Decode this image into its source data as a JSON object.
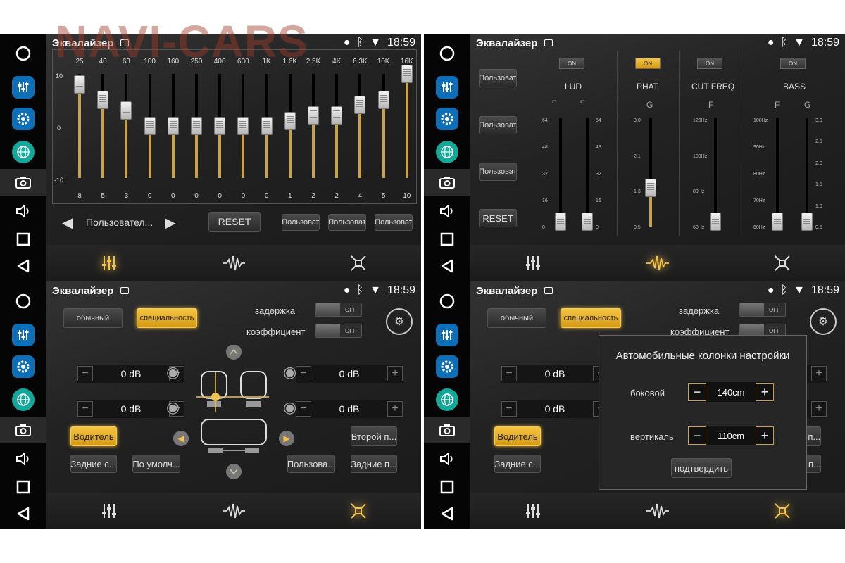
{
  "watermark": "NAVI-CARS",
  "status": {
    "title": "Эквалайзер",
    "time": "18:59"
  },
  "eq": {
    "scale": {
      "top": "10",
      "mid": "0",
      "bottom": "-10"
    },
    "bands": [
      {
        "freq": "25",
        "value": "8",
        "level": 8
      },
      {
        "freq": "40",
        "value": "5",
        "level": 5
      },
      {
        "freq": "63",
        "value": "3",
        "level": 3
      },
      {
        "freq": "100",
        "value": "0",
        "level": 0
      },
      {
        "freq": "160",
        "value": "0",
        "level": 0
      },
      {
        "freq": "250",
        "value": "0",
        "level": 0
      },
      {
        "freq": "400",
        "value": "0",
        "level": 0
      },
      {
        "freq": "630",
        "value": "0",
        "level": 0
      },
      {
        "freq": "1K",
        "value": "0",
        "level": 0
      },
      {
        "freq": "1.6K",
        "value": "1",
        "level": 1
      },
      {
        "freq": "2.5K",
        "value": "2",
        "level": 2
      },
      {
        "freq": "4K",
        "value": "2",
        "level": 2
      },
      {
        "freq": "6.3K",
        "value": "4",
        "level": 4
      },
      {
        "freq": "10K",
        "value": "5",
        "level": 5
      },
      {
        "freq": "16K",
        "value": "10",
        "level": 10
      }
    ],
    "preset_label": "Пользовател...",
    "reset": "RESET",
    "presets": [
      "Пользоват",
      "Пользоват",
      "Пользоват"
    ]
  },
  "advanced": {
    "presets": [
      "Пользоват",
      "Пользоват",
      "Пользоват"
    ],
    "reset": "RESET",
    "on": "ON",
    "lud": {
      "label": "LUD",
      "ticks": [
        "64",
        "48",
        "32",
        "16",
        "0"
      ]
    },
    "phat": {
      "label": "PHAT",
      "sub": "G",
      "ticks": [
        "3.0",
        "2.1",
        "1.3",
        "0.5"
      ]
    },
    "cut": {
      "label": "CUT FREQ",
      "sub": "F",
      "ticks": [
        "120Hz",
        "100Hz",
        "80Hz",
        "60Hz"
      ]
    },
    "bass": {
      "label": "BASS",
      "sub_f": "F",
      "sub_g": "G",
      "f_ticks": [
        "100Hz",
        "90Hz",
        "80Hz",
        "70Hz",
        "60Hz"
      ],
      "g_ticks": [
        "3.0",
        "2.5",
        "2.0",
        "1.5",
        "1.0",
        "0.5"
      ]
    }
  },
  "speakers": {
    "normal": "обычный",
    "special": "специальность",
    "delay": "задержка",
    "coef": "коэффициент",
    "off": "OFF",
    "db_value": "0 dB",
    "driver": "Водитель",
    "rear1": "Задние с...",
    "default": "По умолч...",
    "user": "Пользова...",
    "rear2": "Задние п...",
    "second": "Второй п..."
  },
  "dialog": {
    "title": "Автомобильные колонки настройки",
    "side_label": "боковой",
    "side_value": "140cm",
    "vert_label": "вертикаль",
    "vert_value": "110cm",
    "confirm": "подтвердить"
  }
}
